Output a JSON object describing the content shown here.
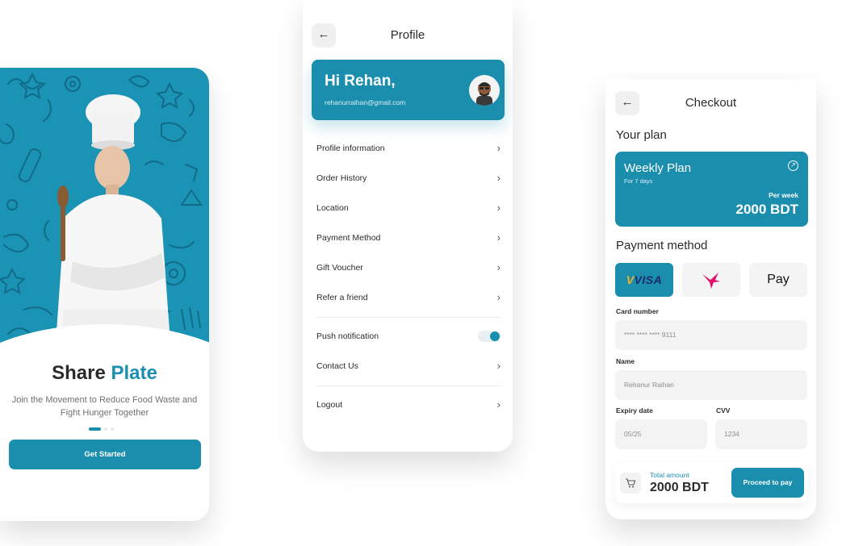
{
  "onboarding": {
    "title_part1": "Share",
    "title_part2": "Plate",
    "subtitle": "Join the Movement to Reduce Food Waste and Fight Hunger Together",
    "cta_label": "Get Started",
    "pager_total": 3,
    "pager_active": 1
  },
  "profile": {
    "back_icon": "arrow-left-icon",
    "title": "Profile",
    "greeting": "Hi Rehan,",
    "email": "rehanurraihan@gmail.com",
    "menu": [
      {
        "label": "Profile information"
      },
      {
        "label": "Order History"
      },
      {
        "label": "Location"
      },
      {
        "label": "Payment Method"
      },
      {
        "label": "Gift Voucher"
      },
      {
        "label": "Refer a friend"
      }
    ],
    "push_label": "Push notification",
    "push_enabled": true,
    "contact_label": "Contact Us",
    "logout_label": "Logout",
    "chevron": "›"
  },
  "checkout": {
    "title": "Checkout",
    "your_plan_label": "Your plan",
    "plan": {
      "name": "Weekly Plan",
      "duration": "For 7 days",
      "per_label": "Per week",
      "price": "2000 BDT"
    },
    "payment_method_label": "Payment method",
    "payment_options": [
      {
        "name": "VISA",
        "selected": true
      },
      {
        "name": "bird-logo-icon",
        "selected": false
      },
      {
        "name": "Pay",
        "selected": false
      }
    ],
    "card_number_label": "Card number",
    "card_number_value": "**** **** **** 9111",
    "name_label": "Name",
    "name_value": "Rehanur Raihan",
    "expiry_label": "Expiry date",
    "expiry_value": "05/25",
    "cvv_label": "CVV",
    "cvv_value": "1234",
    "total_label": "Total amount",
    "total_value": "2000 BDT",
    "pay_button": "Proceed to pay"
  },
  "colors": {
    "primary": "#1b8eae",
    "hero_bg": "#1b93b4",
    "text": "#2b2b2b",
    "muted": "#707070"
  }
}
